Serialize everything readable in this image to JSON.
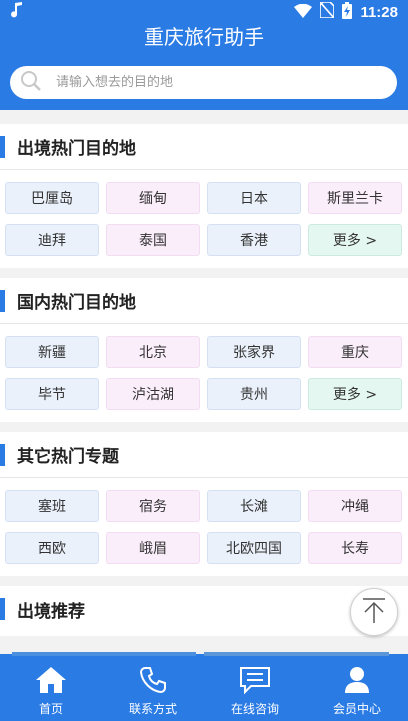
{
  "status_bar": {
    "time": "11:28"
  },
  "header": {
    "title": "重庆旅行助手",
    "search_placeholder": "请输入想去的目的地"
  },
  "sections": [
    {
      "title": "出境热门目的地",
      "tags": [
        {
          "label": "巴厘岛",
          "color": "blue"
        },
        {
          "label": "缅甸",
          "color": "pink"
        },
        {
          "label": "日本",
          "color": "blue"
        },
        {
          "label": "斯里兰卡",
          "color": "pink"
        },
        {
          "label": "迪拜",
          "color": "blue"
        },
        {
          "label": "泰国",
          "color": "pink"
        },
        {
          "label": "香港",
          "color": "blue"
        },
        {
          "label": "更多 >",
          "color": "green"
        }
      ]
    },
    {
      "title": "国内热门目的地",
      "tags": [
        {
          "label": "新疆",
          "color": "blue"
        },
        {
          "label": "北京",
          "color": "pink"
        },
        {
          "label": "张家界",
          "color": "blue"
        },
        {
          "label": "重庆",
          "color": "pink"
        },
        {
          "label": "毕节",
          "color": "blue"
        },
        {
          "label": "泸沽湖",
          "color": "pink"
        },
        {
          "label": "贵州",
          "color": "blue"
        },
        {
          "label": "更多 >",
          "color": "green"
        }
      ]
    },
    {
      "title": "其它热门专题",
      "tags": [
        {
          "label": "塞班",
          "color": "blue"
        },
        {
          "label": "宿务",
          "color": "pink"
        },
        {
          "label": "长滩",
          "color": "blue"
        },
        {
          "label": "冲绳",
          "color": "pink"
        },
        {
          "label": "西欧",
          "color": "blue"
        },
        {
          "label": "峨眉",
          "color": "pink"
        },
        {
          "label": "北欧四国",
          "color": "blue"
        },
        {
          "label": "长寿",
          "color": "pink"
        }
      ]
    },
    {
      "title": "出境推荐",
      "tags": []
    }
  ],
  "tabbar": {
    "items": [
      {
        "label": "首页",
        "icon": "home-icon"
      },
      {
        "label": "联系方式",
        "icon": "phone-icon"
      },
      {
        "label": "在线咨询",
        "icon": "chat-icon"
      },
      {
        "label": "会员中心",
        "icon": "user-icon"
      }
    ]
  },
  "colors": {
    "primary": "#2b7be5",
    "tag_blue": "#eaf1fb",
    "tag_pink": "#fbeefb",
    "tag_green": "#e4f7f0"
  }
}
